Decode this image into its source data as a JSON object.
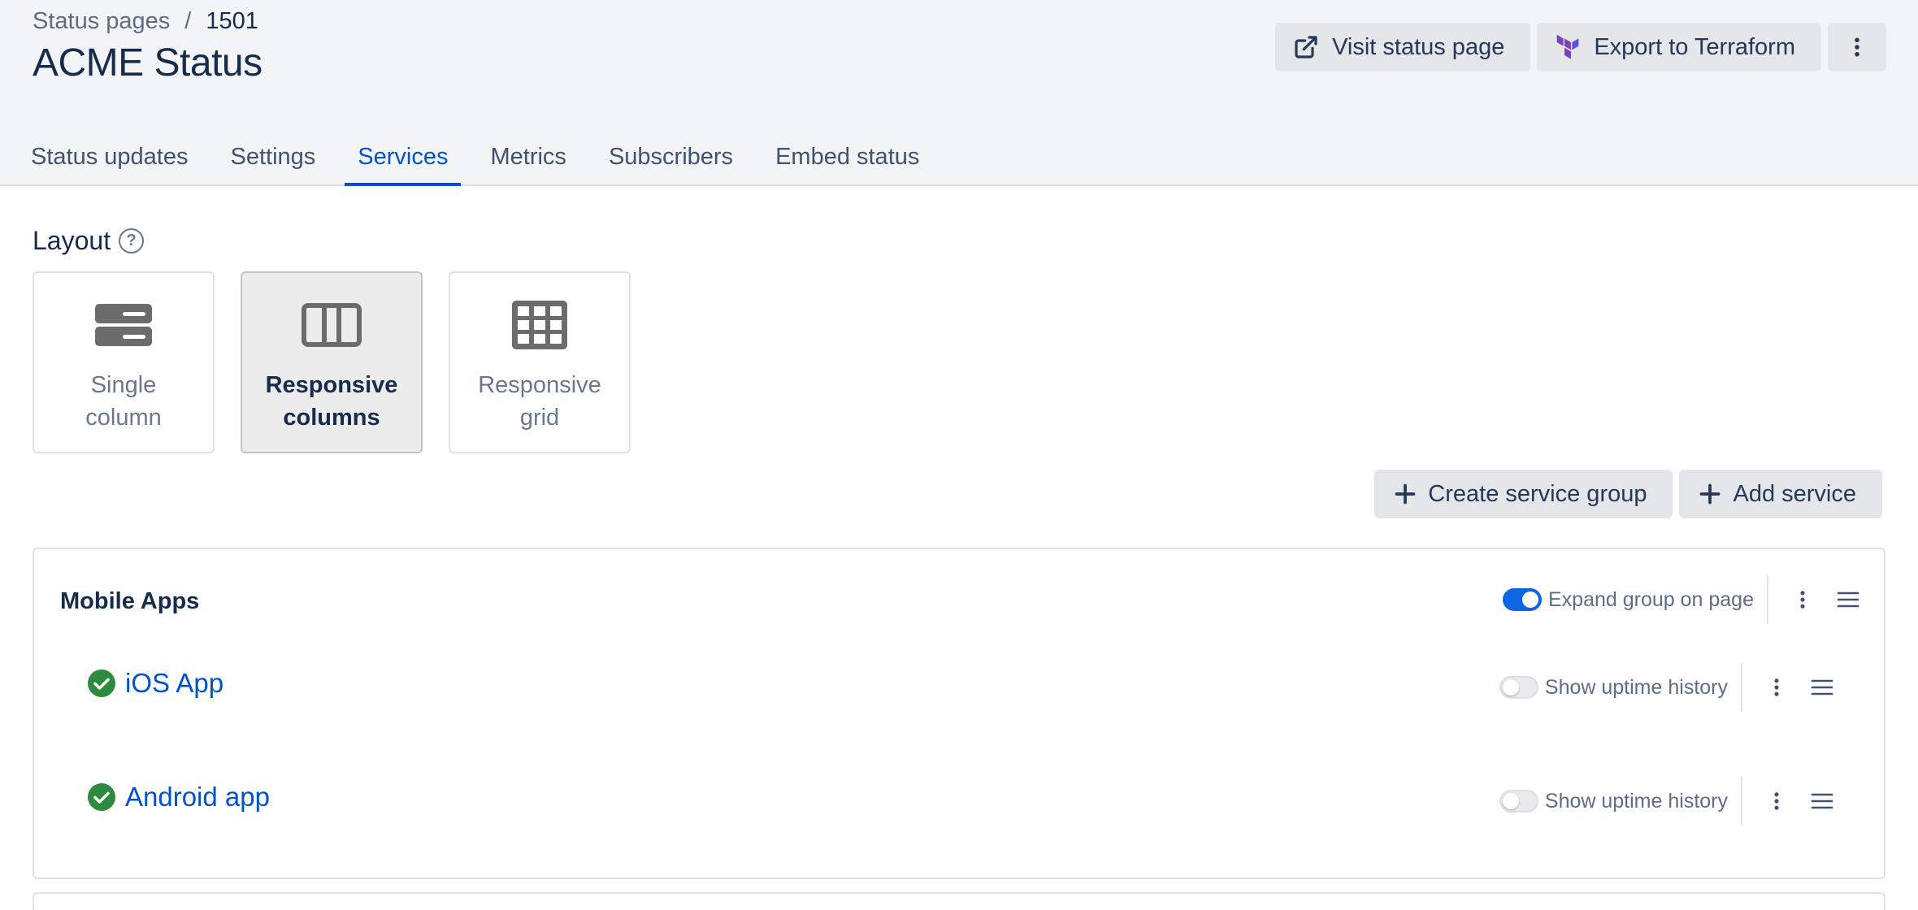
{
  "breadcrumb": {
    "root": "Status pages",
    "separator": "/",
    "current": "1501"
  },
  "page_title": "ACME Status",
  "top_actions": {
    "visit_label": "Visit status page",
    "export_label": "Export to Terraform"
  },
  "tabs": [
    {
      "label": "Status updates"
    },
    {
      "label": "Settings"
    },
    {
      "label": "Services",
      "active": true
    },
    {
      "label": "Metrics"
    },
    {
      "label": "Subscribers"
    },
    {
      "label": "Embed status"
    }
  ],
  "layout": {
    "label": "Layout",
    "options": [
      {
        "line1": "Single",
        "line2": "column",
        "icon": "single-column-icon"
      },
      {
        "line1": "Responsive",
        "line2": "columns",
        "icon": "columns-icon",
        "selected": true
      },
      {
        "line1": "Responsive",
        "line2": "grid",
        "icon": "grid-icon"
      }
    ]
  },
  "actions": {
    "create_group_label": "Create service group",
    "add_service_label": "Add service"
  },
  "group": {
    "title": "Mobile Apps",
    "expand_label": "Expand group on page",
    "expand_on": true,
    "services": [
      {
        "name": "iOS App",
        "status": "operational",
        "uptime_label": "Show uptime history",
        "uptime_on": false
      },
      {
        "name": "Android app",
        "status": "operational",
        "uptime_label": "Show uptime history",
        "uptime_on": false
      }
    ]
  },
  "colors": {
    "accent": "#0052cc",
    "toggle_on": "#0c66e4",
    "operational": "#2e8b3e",
    "terraform": "#7b42bc"
  }
}
